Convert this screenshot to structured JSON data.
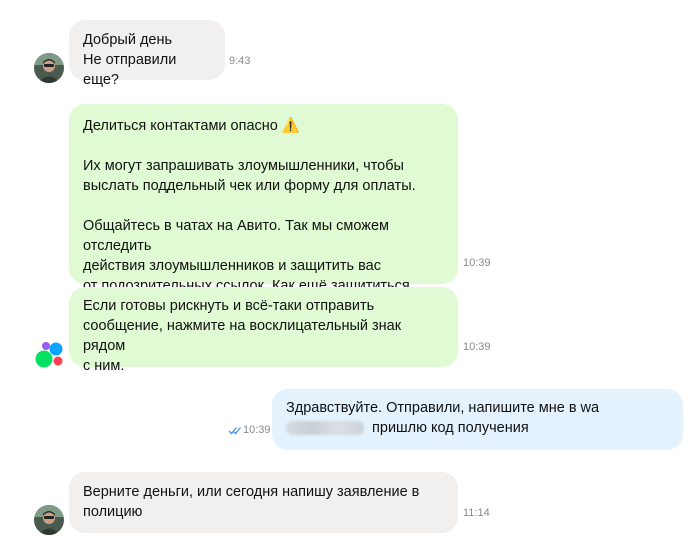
{
  "messages": [
    {
      "lines": [
        "Добрый день",
        "Не отправили еще?"
      ],
      "time": "9:43"
    },
    {
      "warning_title": "Делиться контактами опасно",
      "warning_emoji": "⚠️",
      "para2_lines": [
        "Их могут запрашивать злоумышленники, чтобы",
        "выслать поддельный чек или форму для оплаты."
      ],
      "para3_lines": [
        "Общайтесь в чатах на Авито. Так мы сможем отследить",
        "действия злоумышленников и защитить вас"
      ],
      "para3_last_prefix": "от подозрительных ссылок.",
      "link_text": "Как ещё защититься",
      "time": "10:39"
    },
    {
      "lines": [
        "Если готовы рискнуть и всё-таки отправить",
        "сообщение, нажмите на восклицательный знак рядом",
        "с ним."
      ],
      "time": "10:39"
    },
    {
      "line1": "Здравствуйте. Отправили, напишите мне в wa",
      "line2_suffix": "пришлю код получения",
      "time": "10:39",
      "status_icon": "double-check-icon"
    },
    {
      "lines": [
        "Верните деньги, или сегодня напишу заявление в",
        "полицию"
      ],
      "time": "11:14"
    }
  ],
  "colors": {
    "incoming_grey": "#f1f0ef",
    "system_green": "#e0fbd3",
    "outgoing_blue": "#e3f2fd",
    "read_check": "#4a90d9"
  }
}
